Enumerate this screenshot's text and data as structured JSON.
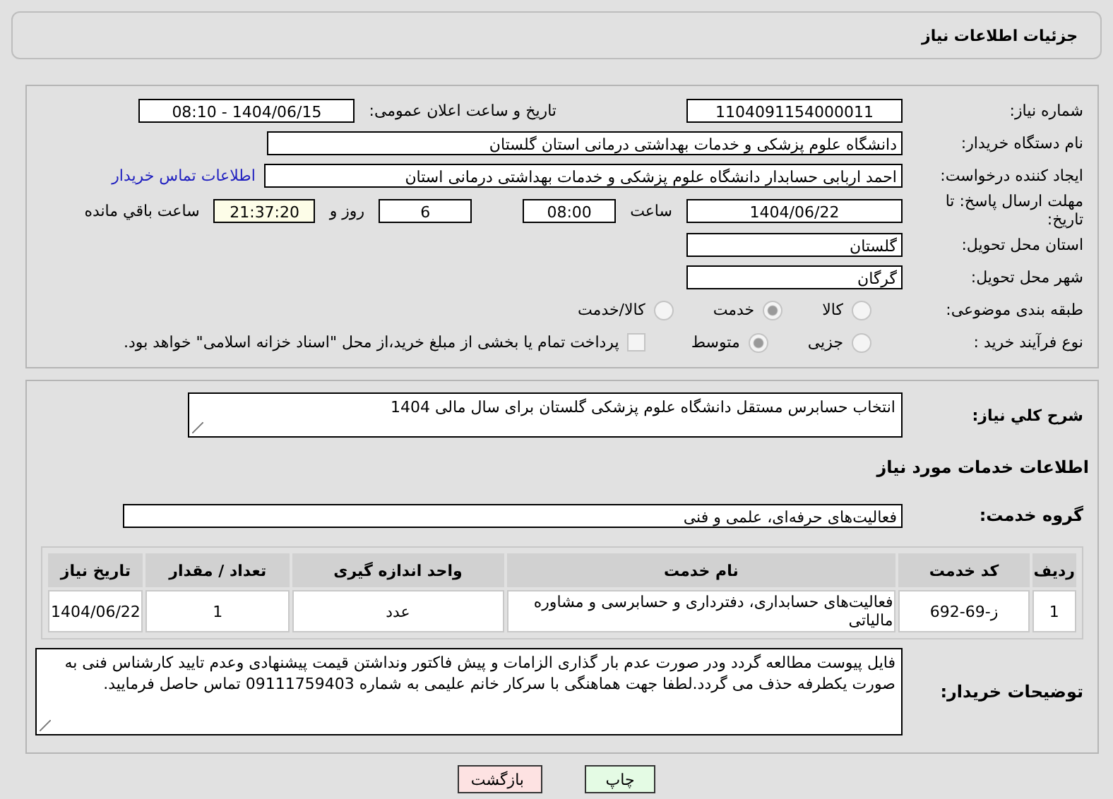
{
  "header": {
    "title": "جزئیات اطلاعات نیاز"
  },
  "details": {
    "need_number": {
      "label": "شماره نیاز:",
      "value": "1104091154000011"
    },
    "announce": {
      "label": "تاریخ و ساعت اعلان عمومی:",
      "value": "1404/06/15 - 08:10"
    },
    "buyer": {
      "label": "نام دستگاه خریدار:",
      "value": "دانشگاه علوم پزشکی و خدمات بهداشتی درمانی استان گلستان"
    },
    "creator": {
      "label": "ایجاد کننده درخواست:",
      "value": "احمد اربابی حسابدار دانشگاه علوم پزشکی و خدمات بهداشتی درمانی استان",
      "link": "اطلاعات تماس خریدار"
    },
    "deadline": {
      "label": "مهلت ارسال پاسخ: تا تاریخ:",
      "date": "1404/06/22",
      "time_label": "ساعت",
      "time": "08:00",
      "days": "6",
      "days_label": "روز و",
      "remaining": "21:37:20",
      "remaining_label": "ساعت باقي مانده"
    },
    "province": {
      "label": "استان محل تحویل:",
      "value": "گلستان"
    },
    "city": {
      "label": "شهر محل تحویل:",
      "value": "گرگان"
    },
    "category": {
      "label": "طبقه بندی موضوعی:",
      "options": [
        {
          "label": "کالا",
          "selected": false
        },
        {
          "label": "خدمت",
          "selected": true
        },
        {
          "label": "کالا/خدمت",
          "selected": false
        }
      ]
    },
    "process": {
      "label": "نوع فرآیند خرید :",
      "options": [
        {
          "label": "جزیی",
          "selected": false
        },
        {
          "label": "متوسط",
          "selected": true
        }
      ],
      "payment": {
        "label": "پرداخت تمام یا بخشی از مبلغ خرید،از محل \"اسناد خزانه اسلامی\" خواهد بود.",
        "checked": false
      }
    }
  },
  "services": {
    "summary": {
      "label": "شرح کلي نیاز:",
      "value": "انتخاب حسابرس مستقل دانشگاه علوم پزشکی گلستان برای سال مالی 1404"
    },
    "section_title": "اطلاعات خدمات مورد نیاز",
    "group": {
      "label": "گروه خدمت:",
      "value": "فعالیت‌های حرفه‌ای، علمی و فنی"
    },
    "table": {
      "columns": [
        "ردیف",
        "کد خدمت",
        "نام خدمت",
        "واحد اندازه گیری",
        "تعداد / مقدار",
        "تاریخ نیاز"
      ],
      "rows": [
        [
          "1",
          "ز-69-692",
          "فعالیت‌های حسابداری، دفترداری و حسابرسی و مشاوره مالیاتی",
          "عدد",
          "1",
          "1404/06/22"
        ]
      ]
    },
    "notes": {
      "label": "توضیحات خریدار:",
      "value": "فایل پیوست مطالعه گردد ودر صورت عدم بار گذاری الزامات و پیش فاکتور ونداشتن قیمت پیشنهادی وعدم تایید کارشناس فنی به صورت یکطرفه حذف می گردد.لطفا جهت هماهنگی با سرکار خانم علیمی به شماره 09111759403 تماس حاصل فرمایید."
    }
  },
  "buttons": [
    {
      "label": "چاپ",
      "kind": "print"
    },
    {
      "label": "بازگشت",
      "kind": "back"
    }
  ]
}
